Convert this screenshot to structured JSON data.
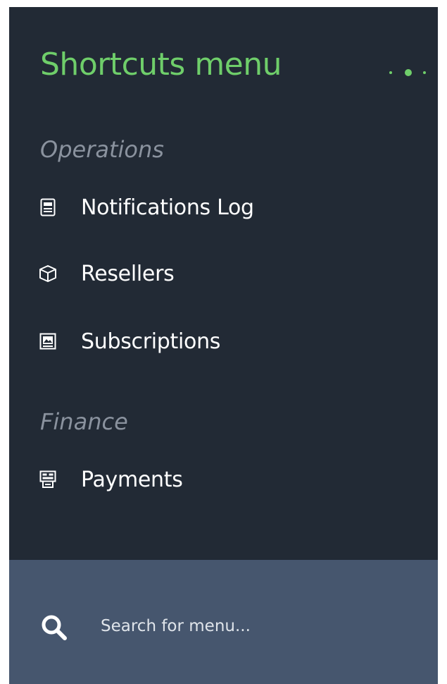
{
  "menu": {
    "title": "Shortcuts menu",
    "options_icon": "more-dots-icon"
  },
  "sections": [
    {
      "label": "Operations",
      "items": [
        {
          "label": "Notifications Log",
          "icon": "notification-log-icon"
        },
        {
          "label": "Resellers",
          "icon": "box-icon"
        },
        {
          "label": "Subscriptions",
          "icon": "subscriptions-icon"
        }
      ]
    },
    {
      "label": "Finance",
      "items": [
        {
          "label": "Payments",
          "icon": "payments-icon"
        }
      ]
    }
  ],
  "search": {
    "placeholder": "Search for menu...",
    "value": "",
    "icon": "search-icon"
  },
  "colors": {
    "panel_bg": "#222a35",
    "accent": "#6fce6a",
    "search_bg": "#46566e",
    "section_label": "#8a929e"
  }
}
